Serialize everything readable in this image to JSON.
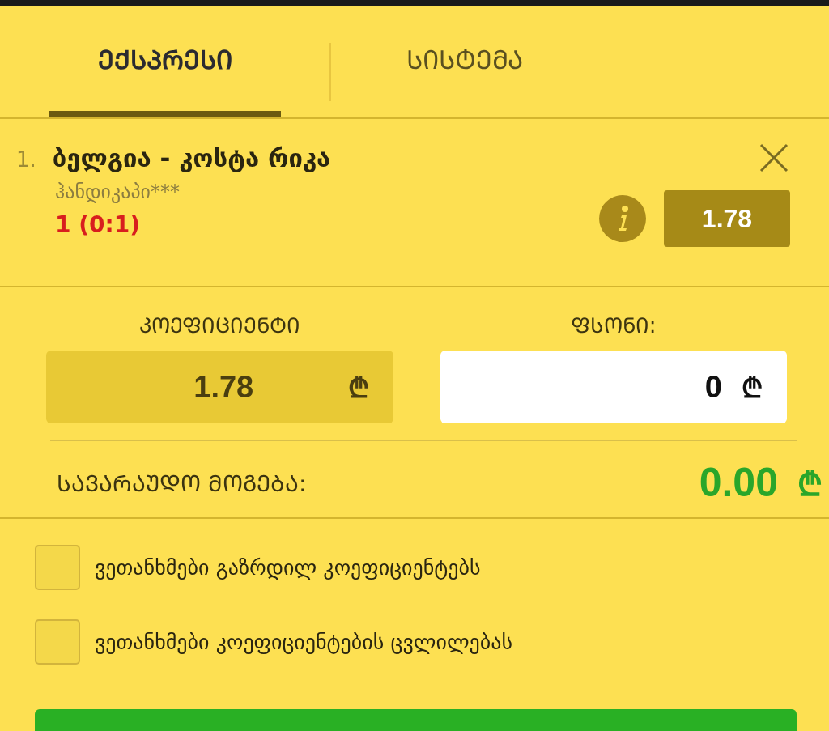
{
  "tabs": [
    {
      "label": "ᲔᲥᲡᲞᲠᲔᲡᲘ",
      "selected": true
    },
    {
      "label": "ᲡᲘᲡᲢᲔᲛᲐ",
      "selected": false
    }
  ],
  "bet": {
    "number": "1.",
    "match": "ბელგია - კოსტა რიკა",
    "market": "ჰანდიკაპი***",
    "pick": "1 (0:1)",
    "odds": "1.78"
  },
  "coefficient": {
    "label": "ᲙᲝᲔᲤᲘᲪᲘᲔᲜᲢᲘ",
    "value": "1.78",
    "currency": "₾"
  },
  "stake": {
    "label": "ᲤᲡᲝᲜᲘ:",
    "value": "0",
    "currency": "₾"
  },
  "winnings": {
    "label": "ᲡᲐᲕᲐᲠᲐᲣᲓᲝ ᲛᲝᲒᲔᲑᲐ:",
    "value": "0.00",
    "currency": "₾"
  },
  "options": [
    {
      "label": "ვეთანხმები გაზრდილ კოეფიციენტებს",
      "checked": false
    },
    {
      "label": "ვეთანხმები კოეფიციენტების ცვლილებას",
      "checked": false
    }
  ]
}
